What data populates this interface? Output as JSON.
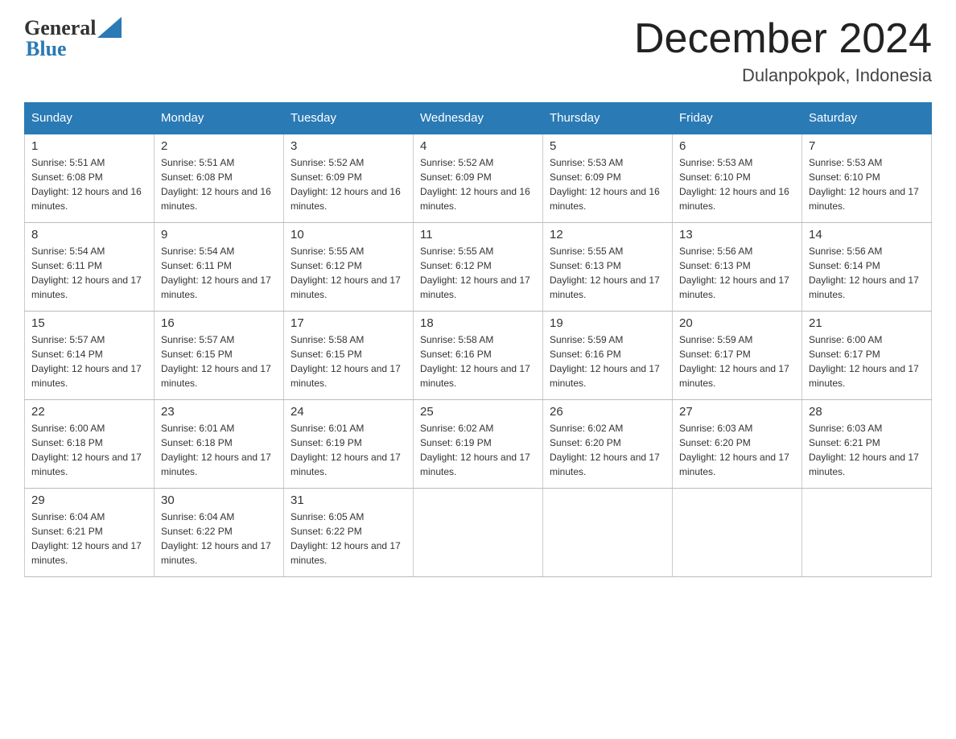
{
  "header": {
    "logo_general": "General",
    "logo_blue": "Blue",
    "month_title": "December 2024",
    "location": "Dulanpokpok, Indonesia"
  },
  "days_of_week": [
    "Sunday",
    "Monday",
    "Tuesday",
    "Wednesday",
    "Thursday",
    "Friday",
    "Saturday"
  ],
  "weeks": [
    [
      {
        "day": "1",
        "sunrise": "5:51 AM",
        "sunset": "6:08 PM",
        "daylight": "12 hours and 16 minutes."
      },
      {
        "day": "2",
        "sunrise": "5:51 AM",
        "sunset": "6:08 PM",
        "daylight": "12 hours and 16 minutes."
      },
      {
        "day": "3",
        "sunrise": "5:52 AM",
        "sunset": "6:09 PM",
        "daylight": "12 hours and 16 minutes."
      },
      {
        "day": "4",
        "sunrise": "5:52 AM",
        "sunset": "6:09 PM",
        "daylight": "12 hours and 16 minutes."
      },
      {
        "day": "5",
        "sunrise": "5:53 AM",
        "sunset": "6:09 PM",
        "daylight": "12 hours and 16 minutes."
      },
      {
        "day": "6",
        "sunrise": "5:53 AM",
        "sunset": "6:10 PM",
        "daylight": "12 hours and 16 minutes."
      },
      {
        "day": "7",
        "sunrise": "5:53 AM",
        "sunset": "6:10 PM",
        "daylight": "12 hours and 17 minutes."
      }
    ],
    [
      {
        "day": "8",
        "sunrise": "5:54 AM",
        "sunset": "6:11 PM",
        "daylight": "12 hours and 17 minutes."
      },
      {
        "day": "9",
        "sunrise": "5:54 AM",
        "sunset": "6:11 PM",
        "daylight": "12 hours and 17 minutes."
      },
      {
        "day": "10",
        "sunrise": "5:55 AM",
        "sunset": "6:12 PM",
        "daylight": "12 hours and 17 minutes."
      },
      {
        "day": "11",
        "sunrise": "5:55 AM",
        "sunset": "6:12 PM",
        "daylight": "12 hours and 17 minutes."
      },
      {
        "day": "12",
        "sunrise": "5:55 AM",
        "sunset": "6:13 PM",
        "daylight": "12 hours and 17 minutes."
      },
      {
        "day": "13",
        "sunrise": "5:56 AM",
        "sunset": "6:13 PM",
        "daylight": "12 hours and 17 minutes."
      },
      {
        "day": "14",
        "sunrise": "5:56 AM",
        "sunset": "6:14 PM",
        "daylight": "12 hours and 17 minutes."
      }
    ],
    [
      {
        "day": "15",
        "sunrise": "5:57 AM",
        "sunset": "6:14 PM",
        "daylight": "12 hours and 17 minutes."
      },
      {
        "day": "16",
        "sunrise": "5:57 AM",
        "sunset": "6:15 PM",
        "daylight": "12 hours and 17 minutes."
      },
      {
        "day": "17",
        "sunrise": "5:58 AM",
        "sunset": "6:15 PM",
        "daylight": "12 hours and 17 minutes."
      },
      {
        "day": "18",
        "sunrise": "5:58 AM",
        "sunset": "6:16 PM",
        "daylight": "12 hours and 17 minutes."
      },
      {
        "day": "19",
        "sunrise": "5:59 AM",
        "sunset": "6:16 PM",
        "daylight": "12 hours and 17 minutes."
      },
      {
        "day": "20",
        "sunrise": "5:59 AM",
        "sunset": "6:17 PM",
        "daylight": "12 hours and 17 minutes."
      },
      {
        "day": "21",
        "sunrise": "6:00 AM",
        "sunset": "6:17 PM",
        "daylight": "12 hours and 17 minutes."
      }
    ],
    [
      {
        "day": "22",
        "sunrise": "6:00 AM",
        "sunset": "6:18 PM",
        "daylight": "12 hours and 17 minutes."
      },
      {
        "day": "23",
        "sunrise": "6:01 AM",
        "sunset": "6:18 PM",
        "daylight": "12 hours and 17 minutes."
      },
      {
        "day": "24",
        "sunrise": "6:01 AM",
        "sunset": "6:19 PM",
        "daylight": "12 hours and 17 minutes."
      },
      {
        "day": "25",
        "sunrise": "6:02 AM",
        "sunset": "6:19 PM",
        "daylight": "12 hours and 17 minutes."
      },
      {
        "day": "26",
        "sunrise": "6:02 AM",
        "sunset": "6:20 PM",
        "daylight": "12 hours and 17 minutes."
      },
      {
        "day": "27",
        "sunrise": "6:03 AM",
        "sunset": "6:20 PM",
        "daylight": "12 hours and 17 minutes."
      },
      {
        "day": "28",
        "sunrise": "6:03 AM",
        "sunset": "6:21 PM",
        "daylight": "12 hours and 17 minutes."
      }
    ],
    [
      {
        "day": "29",
        "sunrise": "6:04 AM",
        "sunset": "6:21 PM",
        "daylight": "12 hours and 17 minutes."
      },
      {
        "day": "30",
        "sunrise": "6:04 AM",
        "sunset": "6:22 PM",
        "daylight": "12 hours and 17 minutes."
      },
      {
        "day": "31",
        "sunrise": "6:05 AM",
        "sunset": "6:22 PM",
        "daylight": "12 hours and 17 minutes."
      },
      null,
      null,
      null,
      null
    ]
  ]
}
